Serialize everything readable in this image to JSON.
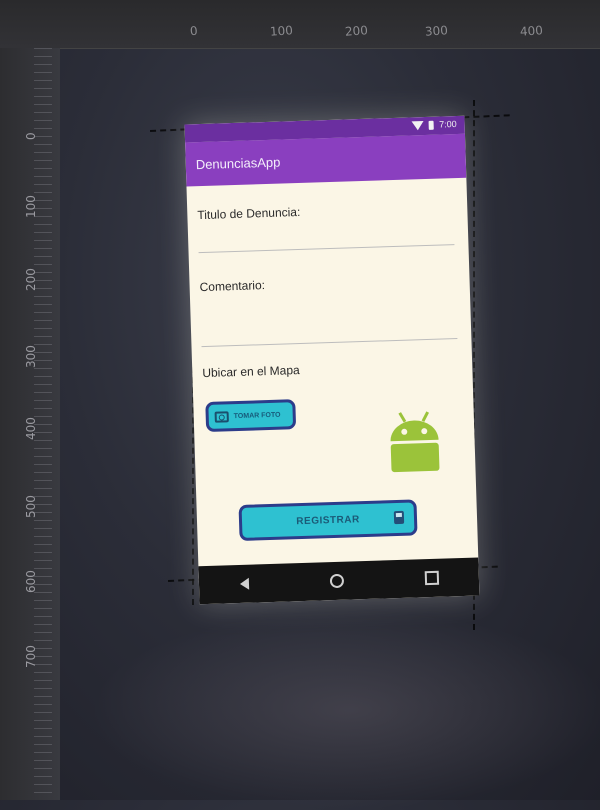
{
  "ide": {
    "ruler_top_ticks": [
      "0",
      "100",
      "200",
      "300",
      "400"
    ],
    "ruler_left_ticks": [
      "0",
      "100",
      "200",
      "300",
      "400",
      "500",
      "600",
      "700"
    ]
  },
  "phone": {
    "status": {
      "time": "7:00"
    },
    "app_title": "DenunciasApp",
    "fields": {
      "title_label": "Titulo de Denuncia:",
      "comment_label": "Comentario:",
      "map_label": "Ubicar en el Mapa"
    },
    "buttons": {
      "take_photo": "TOMAR FOTO",
      "register": "REGISTRAR"
    },
    "colors": {
      "accent": "#8a3fbf",
      "button": "#2ec1d1",
      "android_green": "#9bc33a"
    },
    "icons": [
      "wifi-icon",
      "battery-icon",
      "camera-icon",
      "android-logo",
      "save-icon",
      "back-icon",
      "home-icon",
      "recent-apps-icon"
    ]
  }
}
